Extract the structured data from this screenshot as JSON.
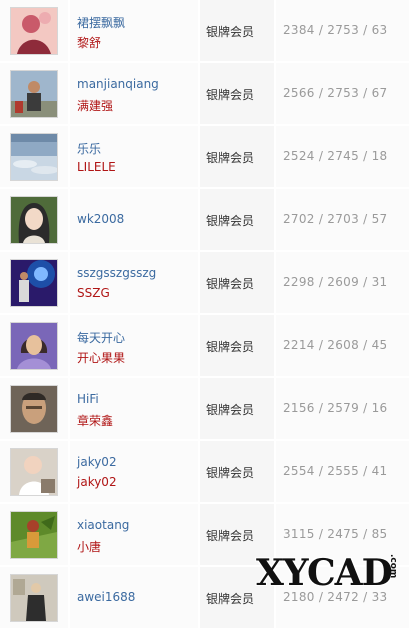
{
  "members": [
    {
      "username": "裙摆飘飘",
      "nickname": "黎舒",
      "level": "银牌会员",
      "stats": "2384 / 2753 / 63",
      "avatar": "woman-in-pink-avatar",
      "colors": [
        "#c95a6a",
        "#f3c8c2",
        "#8e2b3a"
      ]
    },
    {
      "username": "manjianqiang",
      "nickname": "满建强",
      "level": "银牌会员",
      "stats": "2566 / 2753 / 67",
      "avatar": "man-outdoors-avatar",
      "colors": [
        "#9fb6cc",
        "#3b3b3b",
        "#b03a2e"
      ]
    },
    {
      "username": "乐乐",
      "nickname": "LILELE",
      "level": "银牌会员",
      "stats": "2524 / 2745 / 18",
      "avatar": "sky-clouds-avatar",
      "colors": [
        "#8fa9c4",
        "#c9d7e4",
        "#6e8aa8"
      ]
    },
    {
      "username": "wk2008",
      "nickname": "",
      "level": "银牌会员",
      "stats": "2702 / 2703 / 57",
      "avatar": "anime-girl-avatar",
      "colors": [
        "#4f6b3a",
        "#f2d9c7",
        "#2b2b2b"
      ]
    },
    {
      "username": "sszgsszgsszg",
      "nickname": "SSZG",
      "level": "银牌会员",
      "stats": "2298 / 2609 / 31",
      "avatar": "guitar-player-avatar",
      "colors": [
        "#1d4fa8",
        "#7fb8ff",
        "#2a1a6a"
      ]
    },
    {
      "username": "每天开心",
      "nickname": "开心果果",
      "level": "银牌会员",
      "stats": "2214 / 2608 / 45",
      "avatar": "smiling-woman-avatar",
      "colors": [
        "#7a67b8",
        "#e7c19c",
        "#3a2a2a"
      ]
    },
    {
      "username": "HiFi",
      "nickname": "章荣鑫",
      "level": "银牌会员",
      "stats": "2156 / 2579 / 16",
      "avatar": "man-portrait-avatar",
      "colors": [
        "#6f6458",
        "#c9a07c",
        "#2f2a26"
      ]
    },
    {
      "username": "jaky02",
      "nickname": "jaky02",
      "level": "银牌会员",
      "stats": "2554 / 2555 / 41",
      "avatar": "baby-avatar",
      "colors": [
        "#d9d2c8",
        "#f1d3bf",
        "#8a7b6b"
      ]
    },
    {
      "username": "xiaotang",
      "nickname": "小唐",
      "level": "银牌会员",
      "stats": "3115 / 2475 / 85",
      "avatar": "tropical-person-avatar",
      "colors": [
        "#5e8a2a",
        "#d89a3a",
        "#a8402a"
      ]
    },
    {
      "username": "awei1688",
      "nickname": "",
      "level": "银牌会员",
      "stats": "2180 / 2472 / 33",
      "avatar": "man-standing-avatar",
      "colors": [
        "#cfc9bd",
        "#2d2d2d",
        "#e2c9a8"
      ]
    }
  ],
  "watermark": {
    "text": "XYCAD",
    "suffix": ".com"
  }
}
